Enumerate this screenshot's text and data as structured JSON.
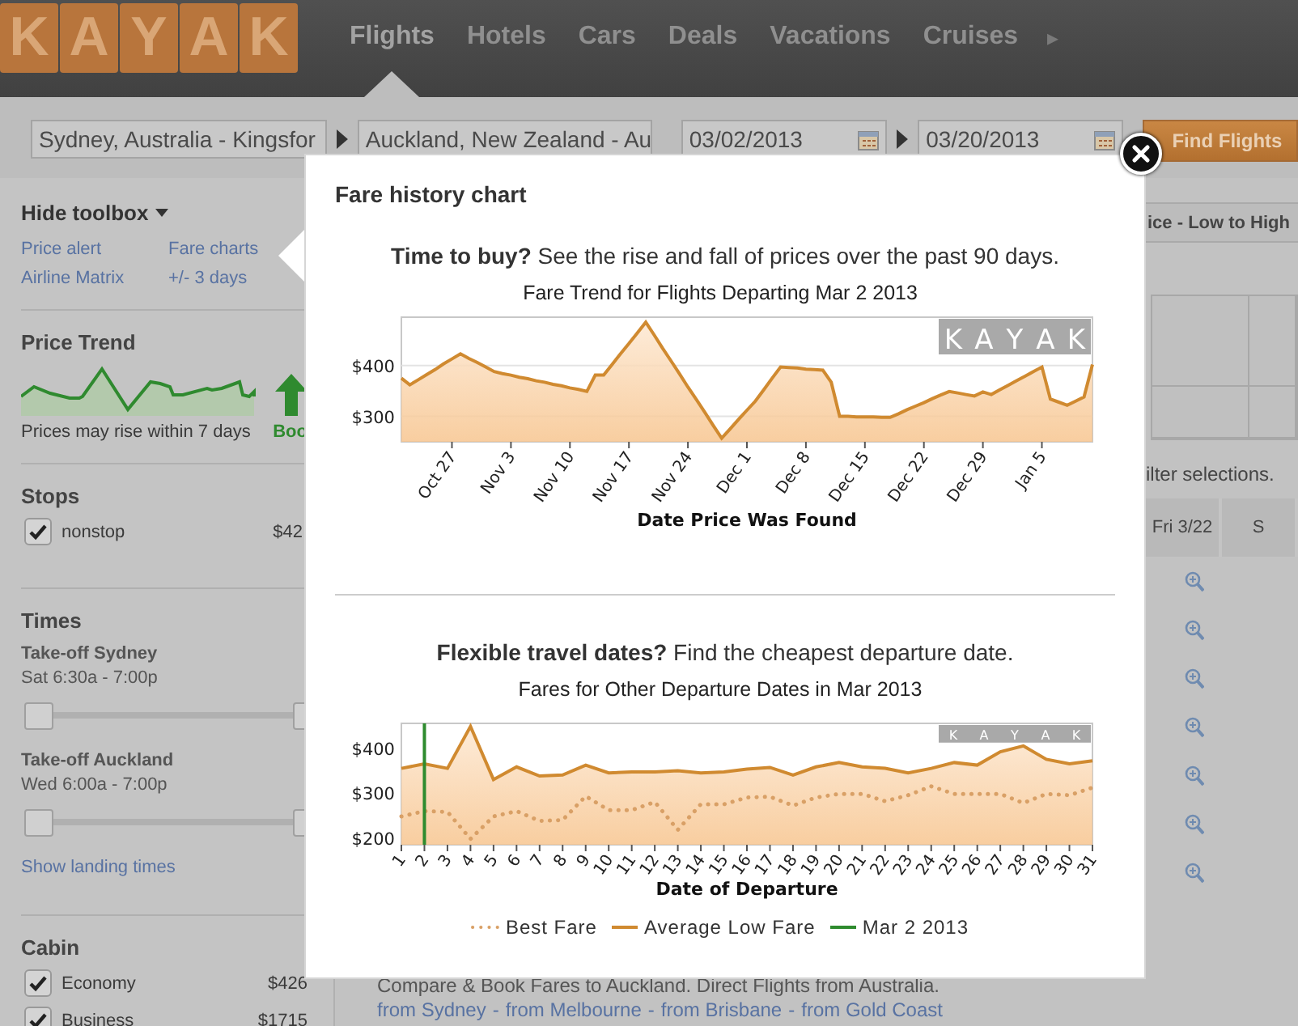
{
  "header": {
    "logo": [
      "K",
      "A",
      "Y",
      "A",
      "K"
    ],
    "nav": [
      {
        "label": "Flights",
        "selected": true
      },
      {
        "label": "Hotels",
        "selected": false
      },
      {
        "label": "Cars",
        "selected": false
      },
      {
        "label": "Deals",
        "selected": false
      },
      {
        "label": "Vacations",
        "selected": false
      },
      {
        "label": "Cruises",
        "selected": false
      }
    ],
    "more": "▸"
  },
  "search": {
    "origin": "Sydney, Australia - Kingsfor",
    "destination": "Auckland, New Zealand - Au",
    "depart": "03/02/2013",
    "return": "03/20/2013",
    "button": "Find Flights"
  },
  "sidebar": {
    "toggle": "Hide toolbox",
    "links": [
      "Price alert",
      "Fare charts",
      "Airline Matrix",
      "+/- 3 days"
    ],
    "price_trend": {
      "title": "Price Trend",
      "note": "Prices may rise within 7 days",
      "advice": "Boo"
    },
    "stops": {
      "title": "Stops",
      "options": [
        {
          "label": "nonstop",
          "price": "$42",
          "checked": true
        }
      ]
    },
    "times": {
      "title": "Times",
      "ranges": [
        {
          "label": "Take-off Sydney",
          "value": "Sat 6:30a - 7:00p",
          "level": 1
        },
        {
          "label": "Take-off Auckland",
          "value": "Wed 6:00a - 7:00p",
          "level": 1
        }
      ],
      "link": "Show landing times"
    },
    "cabin": {
      "title": "Cabin",
      "options": [
        {
          "label": "Economy",
          "price": "$426",
          "checked": true
        },
        {
          "label": "Business",
          "price": "$1715",
          "checked": true
        }
      ]
    }
  },
  "results": {
    "sort": "ice - Low to High",
    "notice": "ilter selections.",
    "columns": [
      "Fri 3/22",
      "S"
    ]
  },
  "footer": {
    "text": "Compare & Book Fares to Auckland. Direct Flights from Australia.",
    "links": [
      "from Sydney",
      "from Melbourne",
      "from Brisbane",
      "from Gold Coast"
    ],
    "separator": "-"
  },
  "modal": {
    "title": "Fare history chart",
    "sections": [
      {
        "lead": "**Time to buy?** See the rise and fall of prices over the past 90 days.",
        "brand": [
          "K",
          "A",
          "Y",
          "A",
          "K"
        ],
        "chart_data": {
          "type": "area",
          "title": "Fare Trend for Flights Departing Mar 2 2013",
          "xlabel": "Date Price Was Found",
          "categories": [
            null,
            null,
            null,
            null,
            null,
            null,
            "Oct 27",
            null,
            null,
            null,
            null,
            null,
            null,
            "Nov 3",
            null,
            null,
            null,
            null,
            null,
            null,
            "Nov 10",
            null,
            null,
            null,
            null,
            null,
            null,
            "Nov 17",
            null,
            null,
            null,
            null,
            null,
            null,
            "Nov 24",
            null,
            null,
            null,
            null,
            null,
            null,
            "Dec 1",
            null,
            null,
            null,
            null,
            null,
            null,
            "Dec 8",
            null,
            null,
            null,
            null,
            null,
            null,
            "Dec 15",
            null,
            null,
            null,
            null,
            null,
            null,
            "Dec 22",
            null,
            null,
            null,
            null,
            null,
            null,
            "Dec 29",
            null,
            null,
            null,
            null,
            null,
            null,
            "Jan 5",
            null,
            null,
            null,
            null,
            null,
            null
          ],
          "series": [
            {
              "color": "#d08a30",
              "values": [
                375,
                362,
                372,
                382,
                392,
                403,
                413,
                423,
                414,
                406,
                397,
                388,
                384,
                381,
                377,
                374,
                370,
                367,
                363,
                360,
                356,
                353,
                349,
                381,
                381,
                402,
                423,
                443,
                464,
                485,
                460,
                434,
                409,
                384,
                358,
                333,
                308,
                282,
                257,
                275,
                294,
                312,
                330,
                352,
                375,
                397,
                396,
                395,
                393,
                392,
                391,
                367,
                300,
                300,
                299,
                299,
                299,
                298,
                298,
                305,
                313,
                320,
                327,
                335,
                342,
                349,
                346,
                343,
                340,
                348,
                343,
                352,
                361,
                370,
                379,
                388,
                397,
                334,
                328,
                322,
                330,
                338,
                402
              ]
            }
          ],
          "ylim": [
            250,
            495
          ],
          "yticks": [
            {
              "value": 300,
              "label": "$300"
            },
            {
              "value": 400,
              "label": "$400"
            }
          ]
        }
      },
      {
        "lead": "**Flexible travel dates?** Find the cheapest departure date.",
        "brand": [
          "K",
          "A",
          "Y",
          "A",
          "K"
        ],
        "chart_data": {
          "type": "area",
          "title": "Fares for Other Departure Dates in Mar 2013",
          "xlabel": "Date of Departure",
          "categories": [
            "1",
            "2",
            "3",
            "4",
            "5",
            "6",
            "7",
            "8",
            "9",
            "10",
            "11",
            "12",
            "13",
            "14",
            "15",
            "16",
            "17",
            "18",
            "19",
            "20",
            "21",
            "22",
            "23",
            "24",
            "25",
            "26",
            "27",
            "28",
            "29",
            "30",
            "31"
          ],
          "legend": "bottom",
          "series": [
            {
              "name": "Best Fare",
              "color": "#d9a066",
              "type": "line",
              "line_style": "dotted",
              "values": [
                248,
                260,
                258,
                198,
                248,
                260,
                238,
                240,
                293,
                262,
                262,
                280,
                218,
                275,
                275,
                290,
                292,
                272,
                290,
                298,
                298,
                282,
                295,
                315,
                298,
                298,
                298,
                278,
                298,
                295,
                312
              ]
            },
            {
              "name": "Average Low Fare",
              "color": "#d08a30",
              "type": "area",
              "values": [
                355,
                365,
                355,
                448,
                330,
                358,
                338,
                340,
                362,
                345,
                347,
                347,
                350,
                345,
                347,
                353,
                357,
                340,
                358,
                368,
                358,
                355,
                345,
                355,
                368,
                362,
                392,
                405,
                375,
                365,
                372
              ]
            }
          ],
          "ylim": [
            185,
            455
          ],
          "yticks": [
            {
              "value": 200,
              "label": "$200"
            },
            {
              "value": 300,
              "label": "$300"
            },
            {
              "value": 400,
              "label": "$400"
            }
          ],
          "ref_lines": [
            {
              "axis": "x",
              "value": "2",
              "label": "Mar 2 2013",
              "color": "#2e8b2e"
            }
          ]
        }
      }
    ]
  }
}
